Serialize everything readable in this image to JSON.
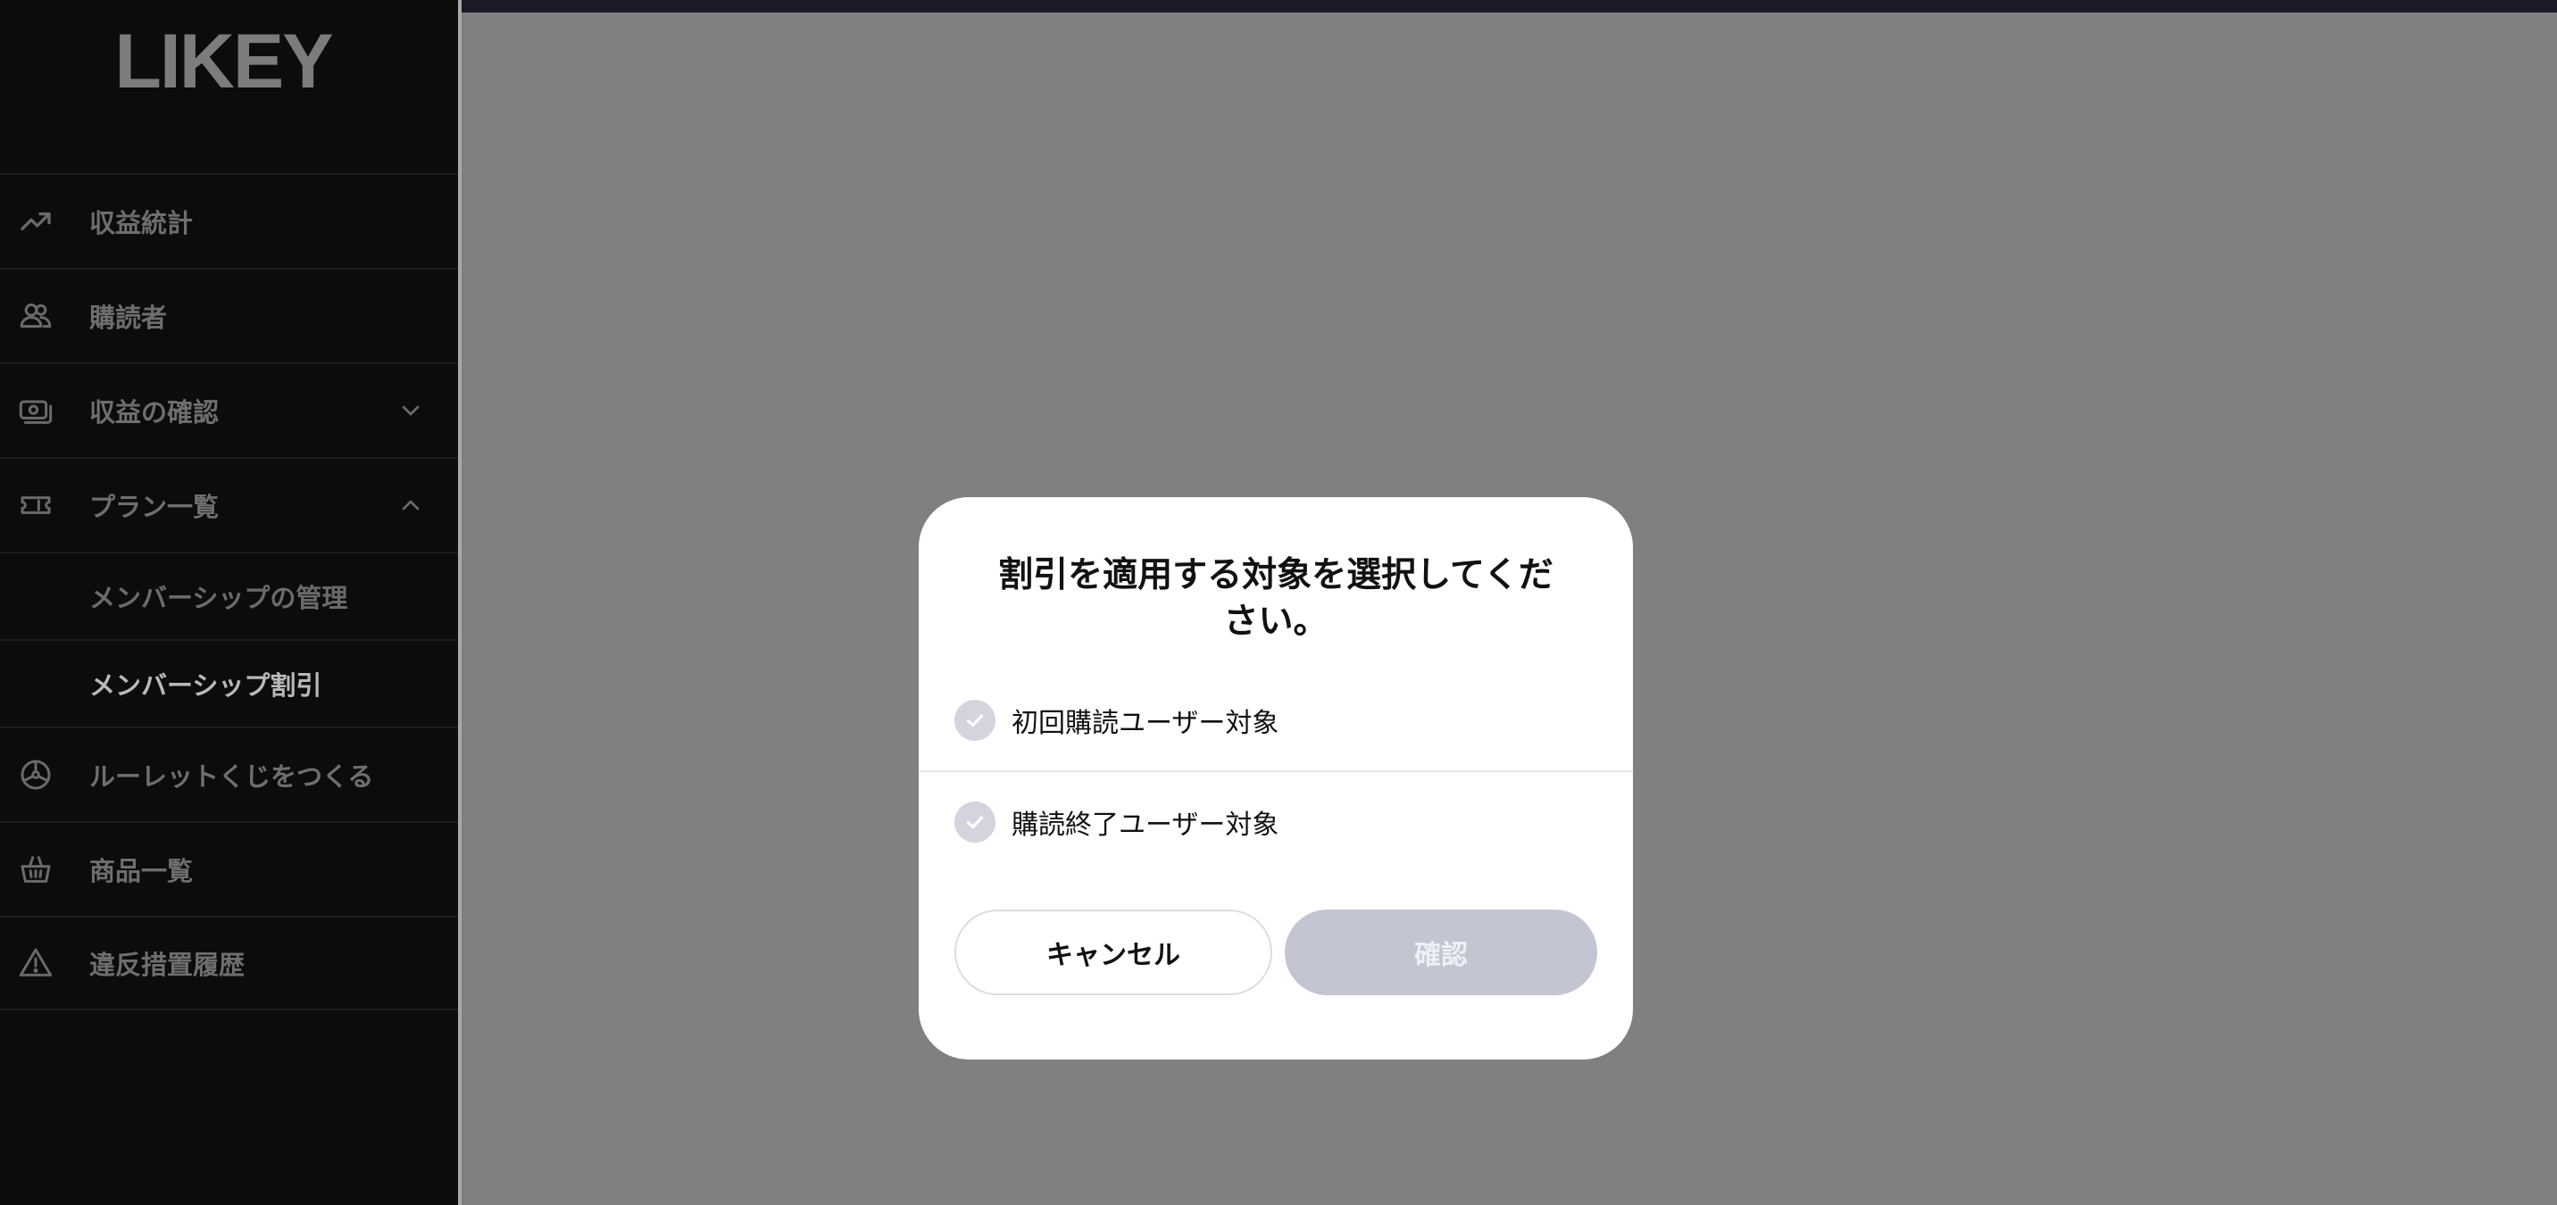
{
  "app": {
    "logo": "LIKEY"
  },
  "sidebar": {
    "items": [
      {
        "label": "収益統計",
        "icon": "trending-up-icon"
      },
      {
        "label": "購読者",
        "icon": "users-icon"
      },
      {
        "label": "収益の確認",
        "icon": "money-icon",
        "chevron": "chevron-down-icon"
      },
      {
        "label": "プラン一覧",
        "icon": "ticket-icon",
        "chevron": "chevron-up-icon"
      },
      {
        "label": "メンバーシップの管理",
        "sub": true
      },
      {
        "label": "メンバーシップ割引",
        "sub": true,
        "active": true
      },
      {
        "label": "ルーレットくじをつくる",
        "icon": "roulette-icon"
      },
      {
        "label": "商品一覧",
        "icon": "basket-icon"
      },
      {
        "label": "違反措置履歴",
        "icon": "warning-icon"
      }
    ]
  },
  "modal": {
    "title": "割引を適用する対象を選択してください。",
    "options": [
      {
        "label": "初回購読ユーザー対象",
        "checked": false
      },
      {
        "label": "購読終了ユーザー対象",
        "checked": false
      }
    ],
    "cancel_label": "キャンセル",
    "confirm_label": "確認"
  },
  "colors": {
    "sidebar_bg": "#0c0c0c",
    "overlay": "#808080",
    "confirm_disabled": "#c3c5d3",
    "check_bg": "#d4d4de"
  }
}
